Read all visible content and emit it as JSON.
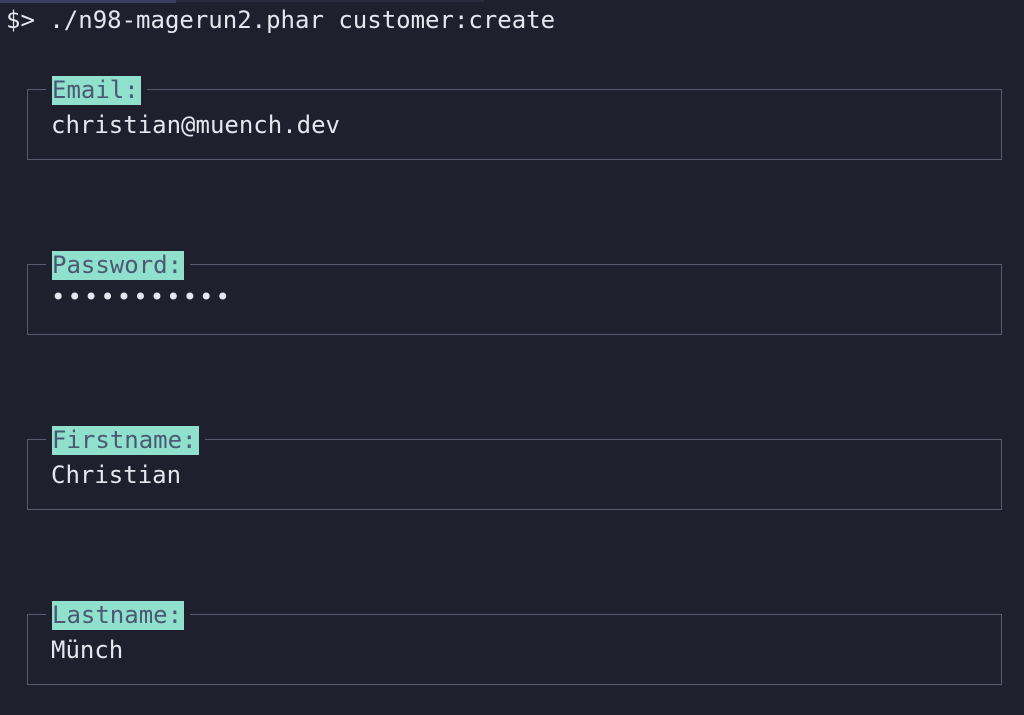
{
  "terminal": {
    "prompt": "$>",
    "command": "./n98-magerun2.phar customer:create"
  },
  "form": {
    "email": {
      "label": "Email:",
      "value": "christian@muench.dev"
    },
    "password": {
      "label": "Password:",
      "value": "•••••••••••"
    },
    "firstname": {
      "label": "Firstname:",
      "value": "Christian"
    },
    "lastname": {
      "label": "Lastname:",
      "value": "Münch"
    }
  },
  "colors": {
    "background": "#1f1f2d",
    "label_highlight": "#8fe1cd",
    "label_text": "#4c5873",
    "border": "#585b70",
    "text": "#e6e6ef"
  }
}
